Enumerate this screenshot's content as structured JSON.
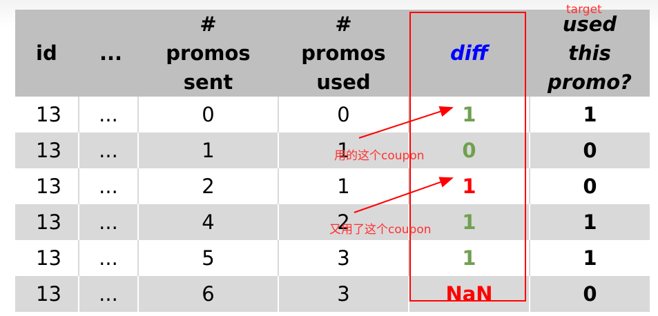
{
  "table": {
    "headers": [
      "id",
      "...",
      "# promos sent",
      "# promos used",
      "diff",
      "used this promo?"
    ],
    "rows": [
      {
        "id": "13",
        "dots": "...",
        "sent": "0",
        "used": "0",
        "diff": "1",
        "target": "1"
      },
      {
        "id": "13",
        "dots": "...",
        "sent": "1",
        "used": "1",
        "diff": "0",
        "target": "0"
      },
      {
        "id": "13",
        "dots": "...",
        "sent": "2",
        "used": "1",
        "diff": "1",
        "target": "0"
      },
      {
        "id": "13",
        "dots": "...",
        "sent": "4",
        "used": "2",
        "diff": "1",
        "target": "1"
      },
      {
        "id": "13",
        "dots": "...",
        "sent": "5",
        "used": "3",
        "diff": "1",
        "target": "1"
      },
      {
        "id": "13",
        "dots": "...",
        "sent": "6",
        "used": "3",
        "diff": "NaN",
        "target": "0"
      }
    ]
  },
  "annotations": {
    "target_label": "target",
    "note_1": "用的这个coupon",
    "note_2": "又用了这个coupon"
  },
  "colors": {
    "header_bg": "#bfbfbf",
    "stripe": "#d9d9d9",
    "diff_header": "#0000ff",
    "diff_green": "#70a050",
    "diff_red": "#ff0000",
    "annotation": "#ff0000"
  }
}
